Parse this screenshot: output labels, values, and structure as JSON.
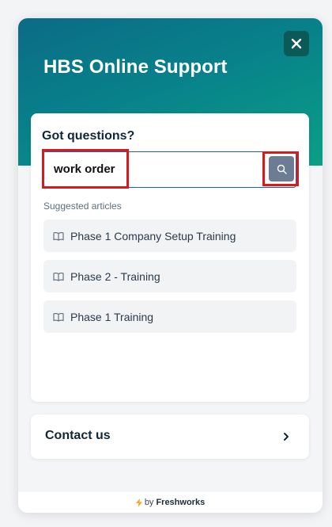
{
  "header": {
    "title": "HBS Online Support",
    "close_icon": "close-icon"
  },
  "search_card": {
    "heading": "Got questions?",
    "search_value": "work order",
    "search_icon": "search-icon",
    "suggested_label": "Suggested articles",
    "articles": [
      {
        "label": "Phase 1 Company Setup Training",
        "icon": "book-icon"
      },
      {
        "label": "Phase 2 - Training",
        "icon": "book-icon"
      },
      {
        "label": "Phase 1 Training",
        "icon": "book-icon"
      }
    ]
  },
  "contact": {
    "label": "Contact us",
    "icon": "chevron-right-icon"
  },
  "footer": {
    "by": "by",
    "brand": "Freshworks",
    "icon": "bolt-icon"
  },
  "colors": {
    "header_gradient_start": "#0b6b86",
    "header_gradient_end": "#0a9f86",
    "highlight": "#d9191c",
    "search_button": "#6b7c93"
  }
}
